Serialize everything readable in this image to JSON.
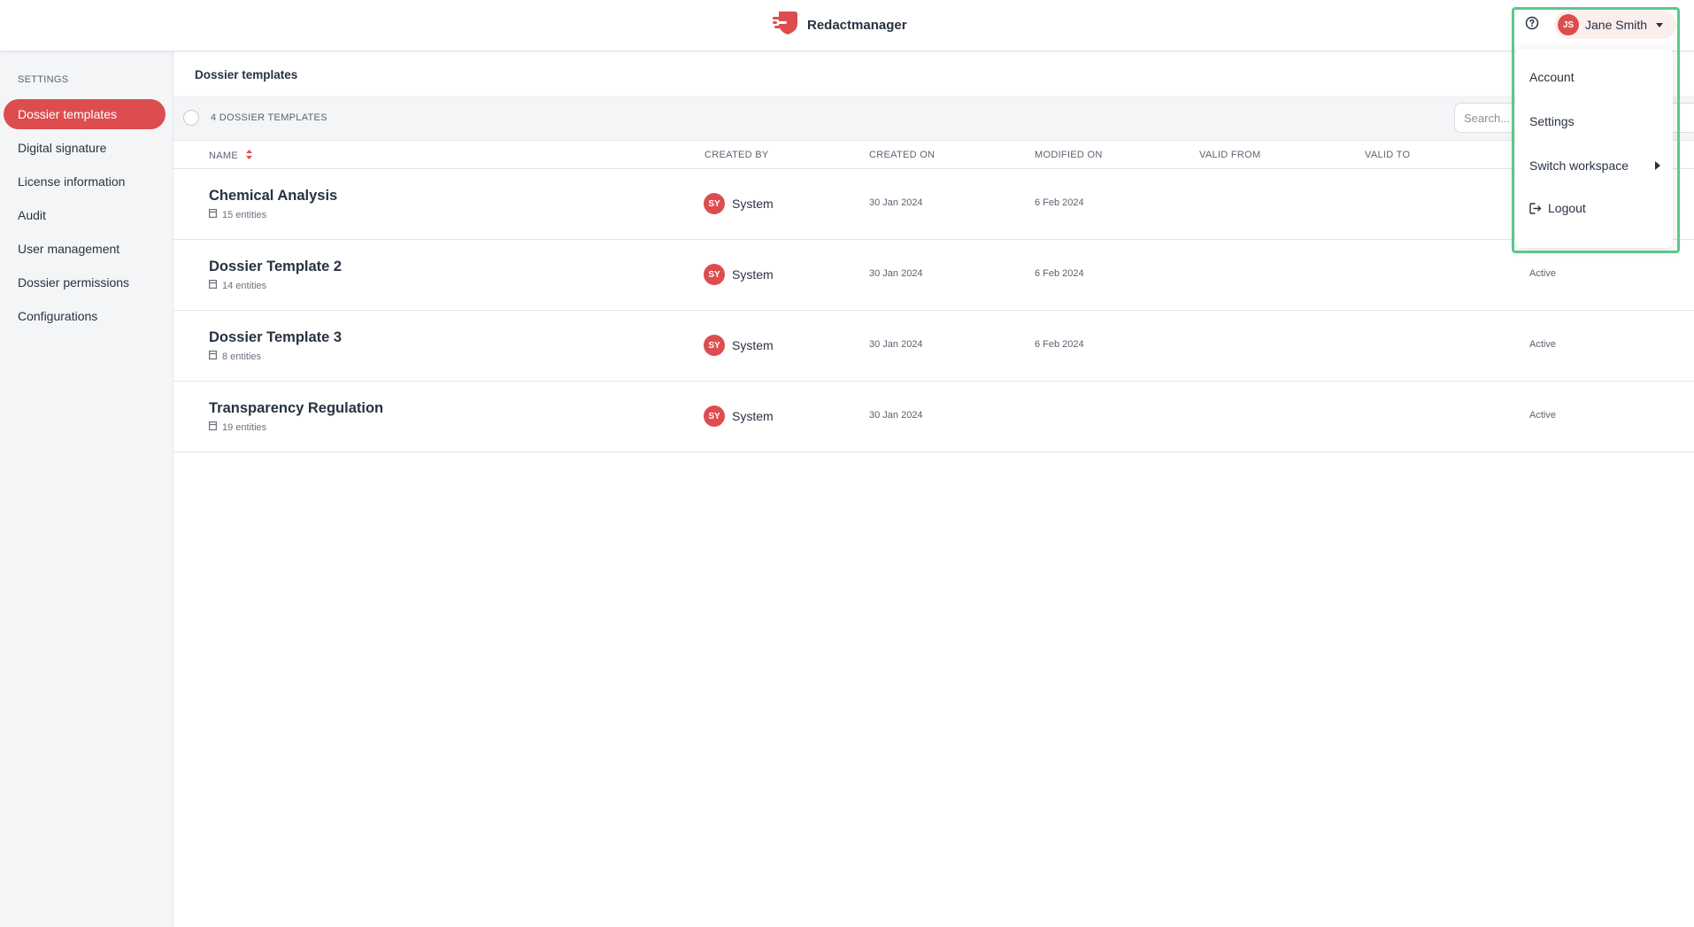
{
  "header": {
    "app_name": "Redactmanager",
    "user": {
      "initials": "JS",
      "name": "Jane Smith"
    }
  },
  "sidebar": {
    "section_label": "SETTINGS",
    "items": [
      {
        "label": "Dossier templates",
        "active": true
      },
      {
        "label": "Digital signature"
      },
      {
        "label": "License information"
      },
      {
        "label": "Audit"
      },
      {
        "label": "User management"
      },
      {
        "label": "Dossier permissions"
      },
      {
        "label": "Configurations"
      }
    ]
  },
  "main": {
    "title": "Dossier templates",
    "count_label": "4 DOSSIER TEMPLATES",
    "search_placeholder": "Search...",
    "columns": {
      "name": "NAME",
      "created_by": "CREATED BY",
      "created_on": "CREATED ON",
      "modified_on": "MODIFIED ON",
      "valid_from": "VALID FROM",
      "valid_to": "VALID TO"
    },
    "rows": [
      {
        "name": "Chemical Analysis",
        "entities": "15 entities",
        "creator_initials": "SY",
        "creator": "System",
        "created_on": "30 Jan 2024",
        "modified_on": "6 Feb 2024",
        "status": ""
      },
      {
        "name": "Dossier Template 2",
        "entities": "14 entities",
        "creator_initials": "SY",
        "creator": "System",
        "created_on": "30 Jan 2024",
        "modified_on": "6 Feb 2024",
        "status": "Active"
      },
      {
        "name": "Dossier Template 3",
        "entities": "8 entities",
        "creator_initials": "SY",
        "creator": "System",
        "created_on": "30 Jan 2024",
        "modified_on": "6 Feb 2024",
        "status": "Active"
      },
      {
        "name": "Transparency Regulation",
        "entities": "19 entities",
        "creator_initials": "SY",
        "creator": "System",
        "created_on": "30 Jan 2024",
        "modified_on": "",
        "status": "Active"
      }
    ]
  },
  "user_menu": {
    "items": [
      {
        "label": "Account"
      },
      {
        "label": "Settings"
      },
      {
        "label": "Switch workspace"
      },
      {
        "label": "Logout"
      }
    ]
  },
  "colors": {
    "accent": "#dd4d50",
    "highlight": "#5cc88a",
    "sidebar_bg": "#f4f5f7",
    "text": "#283241"
  }
}
